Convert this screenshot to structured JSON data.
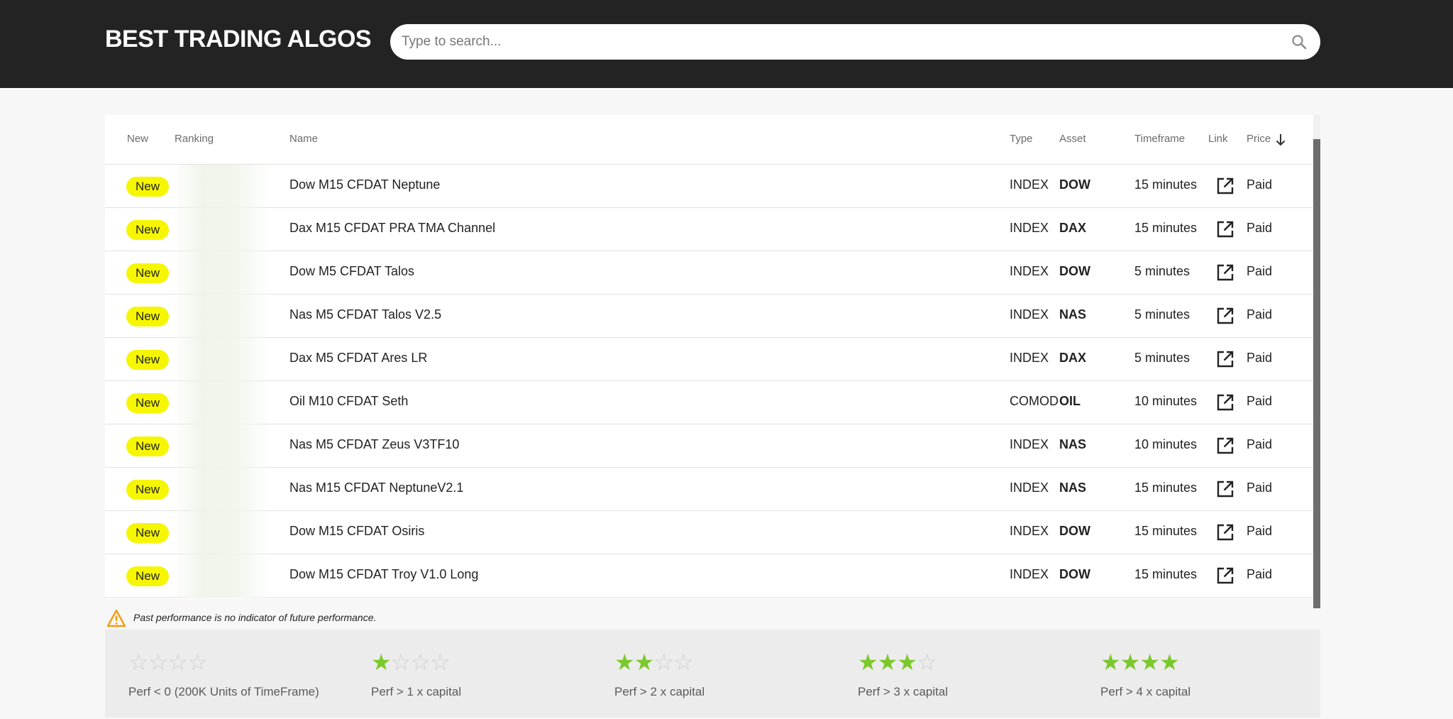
{
  "header": {
    "title": "BEST TRADING ALGOS",
    "search_placeholder": "Type to search..."
  },
  "table": {
    "columns": {
      "new": "New",
      "ranking": "Ranking",
      "name": "Name",
      "type": "Type",
      "asset": "Asset",
      "timeframe": "Timeframe",
      "link": "Link",
      "price": "Price"
    },
    "sort": {
      "column": "Price",
      "direction": "descending"
    },
    "rows": [
      {
        "badge": "New",
        "name": "Dow M15 CFDAT Neptune",
        "type": "INDEX",
        "asset": "DOW",
        "timeframe": "15 minutes",
        "price": "Paid"
      },
      {
        "badge": "New",
        "name": "Dax M15 CFDAT PRA TMA Channel",
        "type": "INDEX",
        "asset": "DAX",
        "timeframe": "15 minutes",
        "price": "Paid"
      },
      {
        "badge": "New",
        "name": "Dow M5 CFDAT Talos",
        "type": "INDEX",
        "asset": "DOW",
        "timeframe": "5 minutes",
        "price": "Paid"
      },
      {
        "badge": "New",
        "name": "Nas M5 CFDAT Talos V2.5",
        "type": "INDEX",
        "asset": "NAS",
        "timeframe": "5 minutes",
        "price": "Paid"
      },
      {
        "badge": "New",
        "name": "Dax M5 CFDAT Ares LR",
        "type": "INDEX",
        "asset": "DAX",
        "timeframe": "5 minutes",
        "price": "Paid"
      },
      {
        "badge": "New",
        "name": "Oil M10 CFDAT Seth",
        "type": "COMOD",
        "asset": "OIL",
        "timeframe": "10 minutes",
        "price": "Paid"
      },
      {
        "badge": "New",
        "name": "Nas M5 CFDAT Zeus V3TF10",
        "type": "INDEX",
        "asset": "NAS",
        "timeframe": "10 minutes",
        "price": "Paid"
      },
      {
        "badge": "New",
        "name": "Nas M15 CFDAT NeptuneV2.1",
        "type": "INDEX",
        "asset": "NAS",
        "timeframe": "15 minutes",
        "price": "Paid"
      },
      {
        "badge": "New",
        "name": "Dow M15 CFDAT Osiris",
        "type": "INDEX",
        "asset": "DOW",
        "timeframe": "15 minutes",
        "price": "Paid"
      },
      {
        "badge": "New",
        "name": "Dow M15 CFDAT Troy V1.0 Long",
        "type": "INDEX",
        "asset": "DOW",
        "timeframe": "15 minutes",
        "price": "Paid"
      }
    ]
  },
  "disclaimer": "Past performance is no indicator of future performance.",
  "legend": [
    {
      "stars": 0,
      "label": "Perf < 0 (200K Units of TimeFrame)"
    },
    {
      "stars": 1,
      "label": "Perf > 1 x capital"
    },
    {
      "stars": 2,
      "label": "Perf > 2 x capital"
    },
    {
      "stars": 3,
      "label": "Perf > 3 x capital"
    },
    {
      "stars": 4,
      "label": "Perf > 4 x capital"
    }
  ],
  "colors": {
    "topbar": "#232323",
    "badge": "#f6f600",
    "star_on": "#7cc82c",
    "star_off": "#cfcfcf",
    "warning": "#f39c12"
  },
  "icons": {
    "search": "search-icon",
    "sort": "arrow-down-icon",
    "link": "external-link-icon",
    "warning": "warning-icon",
    "star": "star-icon"
  }
}
